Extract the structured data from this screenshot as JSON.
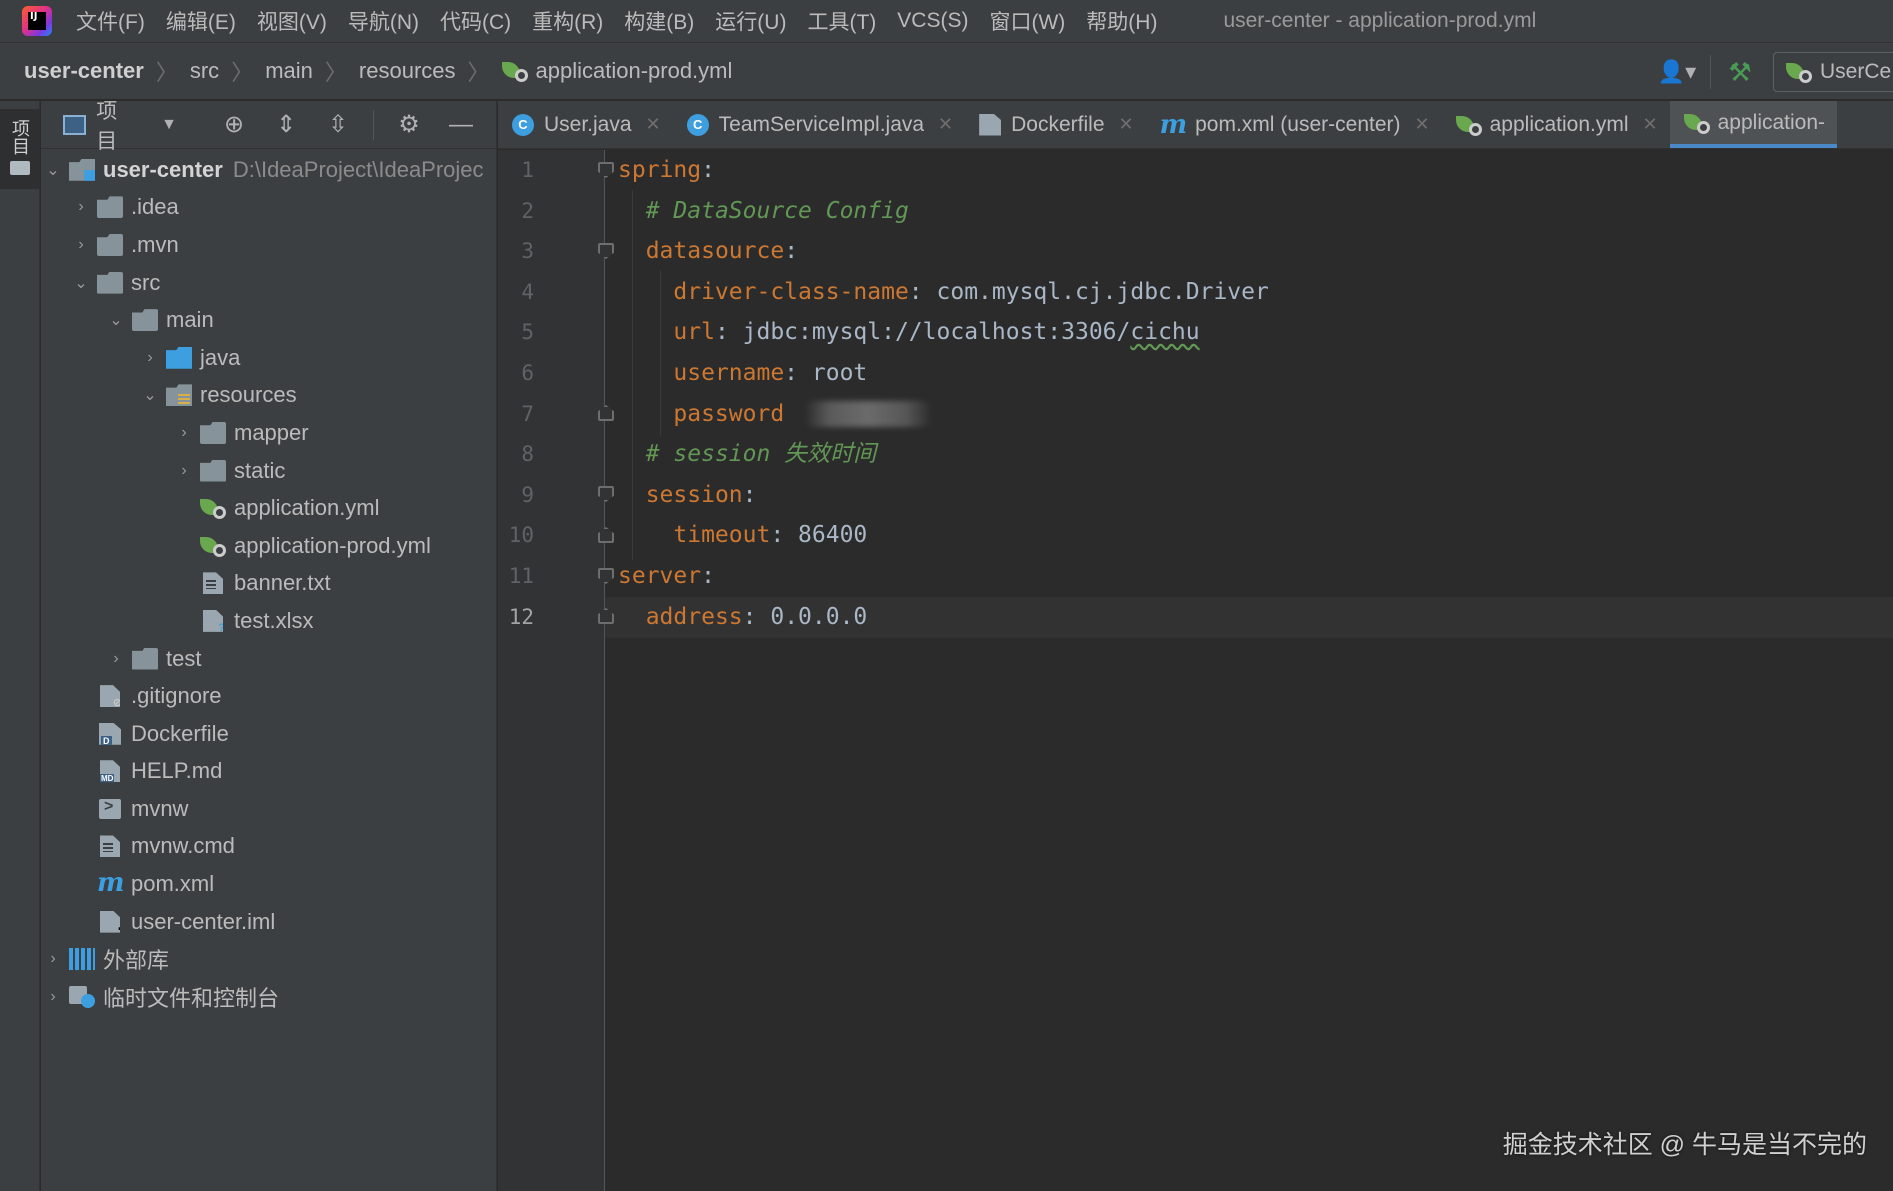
{
  "menubar": {
    "logo": "IJ",
    "items": [
      "文件(F)",
      "编辑(E)",
      "视图(V)",
      "导航(N)",
      "代码(C)",
      "重构(R)",
      "构建(B)",
      "运行(U)",
      "工具(T)",
      "VCS(S)",
      "窗口(W)",
      "帮助(H)"
    ],
    "window_title": "user-center - application-prod.yml"
  },
  "navbar": {
    "breadcrumbs": [
      "user-center",
      "src",
      "main",
      "resources",
      "application-prod.yml"
    ],
    "run_config": "UserCe"
  },
  "tool_strip": {
    "project_tab": "项目"
  },
  "project_panel": {
    "view_label": "项目",
    "tree": [
      {
        "label": "user-center",
        "path": "D:\\IdeaProject\\IdeaProjec"
      },
      {
        "label": ".idea"
      },
      {
        "label": ".mvn"
      },
      {
        "label": "src"
      },
      {
        "label": "main"
      },
      {
        "label": "java"
      },
      {
        "label": "resources"
      },
      {
        "label": "mapper"
      },
      {
        "label": "static"
      },
      {
        "label": "application.yml"
      },
      {
        "label": "application-prod.yml"
      },
      {
        "label": "banner.txt"
      },
      {
        "label": "test.xlsx"
      },
      {
        "label": "test"
      },
      {
        "label": ".gitignore"
      },
      {
        "label": "Dockerfile"
      },
      {
        "label": "HELP.md"
      },
      {
        "label": "mvnw"
      },
      {
        "label": "mvnw.cmd"
      },
      {
        "label": "pom.xml"
      },
      {
        "label": "user-center.iml"
      },
      {
        "label": "外部库"
      },
      {
        "label": "临时文件和控制台"
      }
    ]
  },
  "tabs": [
    {
      "label": "User.java"
    },
    {
      "label": "TeamServiceImpl.java"
    },
    {
      "label": "Dockerfile"
    },
    {
      "label": "pom.xml (user-center)"
    },
    {
      "label": "application.yml"
    },
    {
      "label": "application-"
    }
  ],
  "editor": {
    "line_numbers": [
      "1",
      "2",
      "3",
      "4",
      "5",
      "6",
      "7",
      "8",
      "9",
      "10",
      "11",
      "12"
    ],
    "current_line": 12,
    "code": {
      "l1_key": "spring",
      "l2_comment": "# DataSource Config",
      "l3_key": "datasource",
      "l4_key": "driver-class-name",
      "l4_val": "com.mysql.cj.jdbc.Driver",
      "l5_key": "url",
      "l5_val_a": "jdbc:mysql://localhost:3306/",
      "l5_val_b": "cichu",
      "l6_key": "username",
      "l6_val": "root",
      "l7_key": "password",
      "l8_comment": "# session 失效时间",
      "l9_key": "session",
      "l10_key": "timeout",
      "l10_val": "86400",
      "l11_key": "server",
      "l12_key": "address",
      "l12_val": "0.0.0.0"
    }
  },
  "watermark": "掘金技术社区 @ 牛马是当不完的",
  "colors": {
    "key": "#cc7832",
    "comment": "#629755",
    "text": "#a9b7c6",
    "tab_underline": "#4a88c7",
    "background": "#2b2b2b",
    "panel": "#3c3f41"
  }
}
